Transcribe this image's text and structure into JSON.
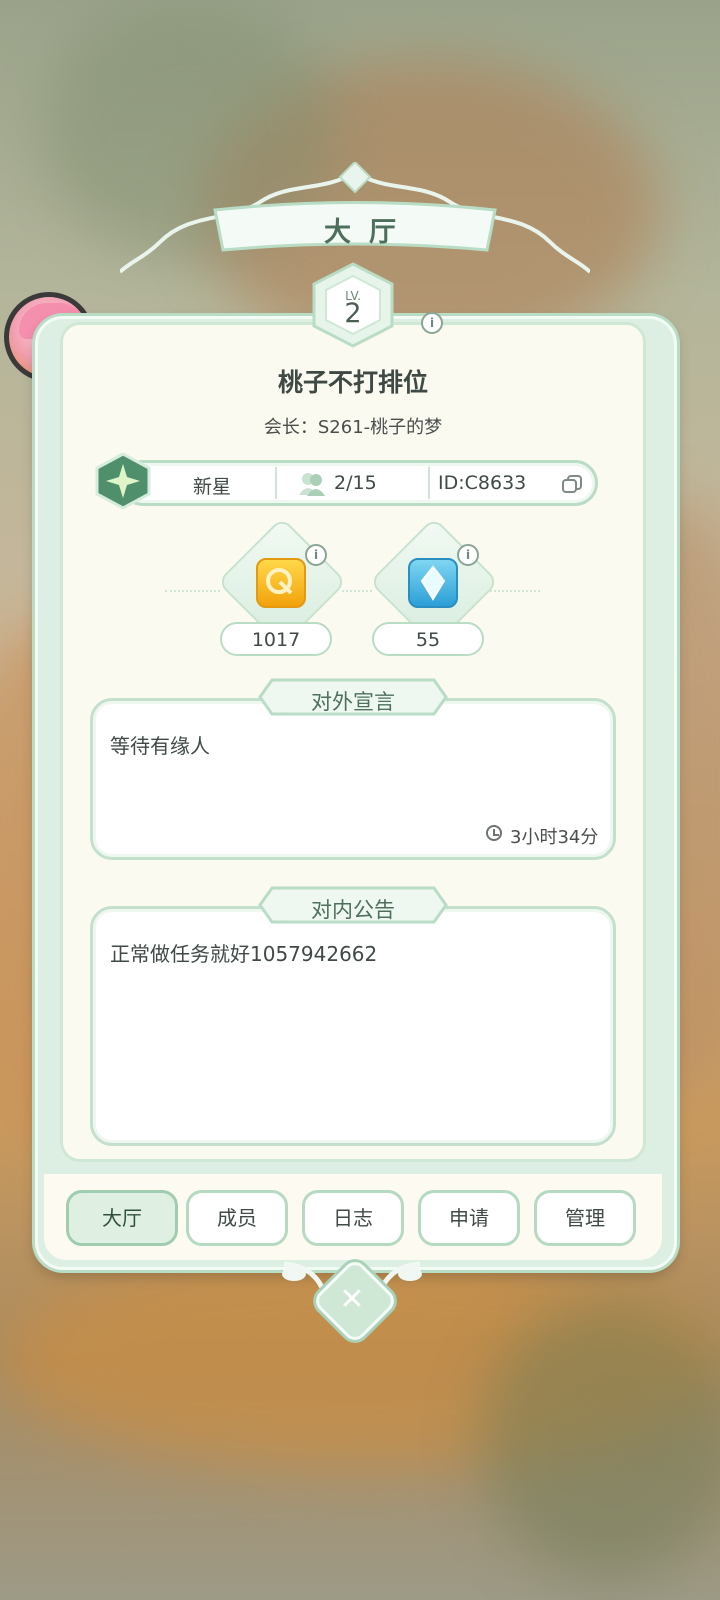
{
  "hall": {
    "title": "大厅",
    "level_label": "LV.",
    "level": "2",
    "guild_name": "桃子不打排位",
    "leader": "会长：S261-桃子的梦",
    "rank": "新星",
    "members": "2/15",
    "guild_id": "ID:C8633"
  },
  "currencies": [
    {
      "icon": "gold-token-icon",
      "value": "1017"
    },
    {
      "icon": "blue-crystal-icon",
      "value": "55"
    }
  ],
  "declaration": {
    "title": "对外宣言",
    "text": "等待有缘人",
    "time": "3小时34分"
  },
  "notice": {
    "title": "对内公告",
    "text": "正常做任务就好1057942662"
  },
  "tabs": [
    {
      "label": "大厅",
      "active": true
    },
    {
      "label": "成员",
      "active": false
    },
    {
      "label": "日志",
      "active": false
    },
    {
      "label": "申请",
      "active": false
    },
    {
      "label": "管理",
      "active": false
    }
  ],
  "colors": {
    "accent_green": "#b9dcc5",
    "panel_bg": "#fbfaf1",
    "text_dark": "#3f4a44",
    "title_green": "#4e6f5c"
  }
}
